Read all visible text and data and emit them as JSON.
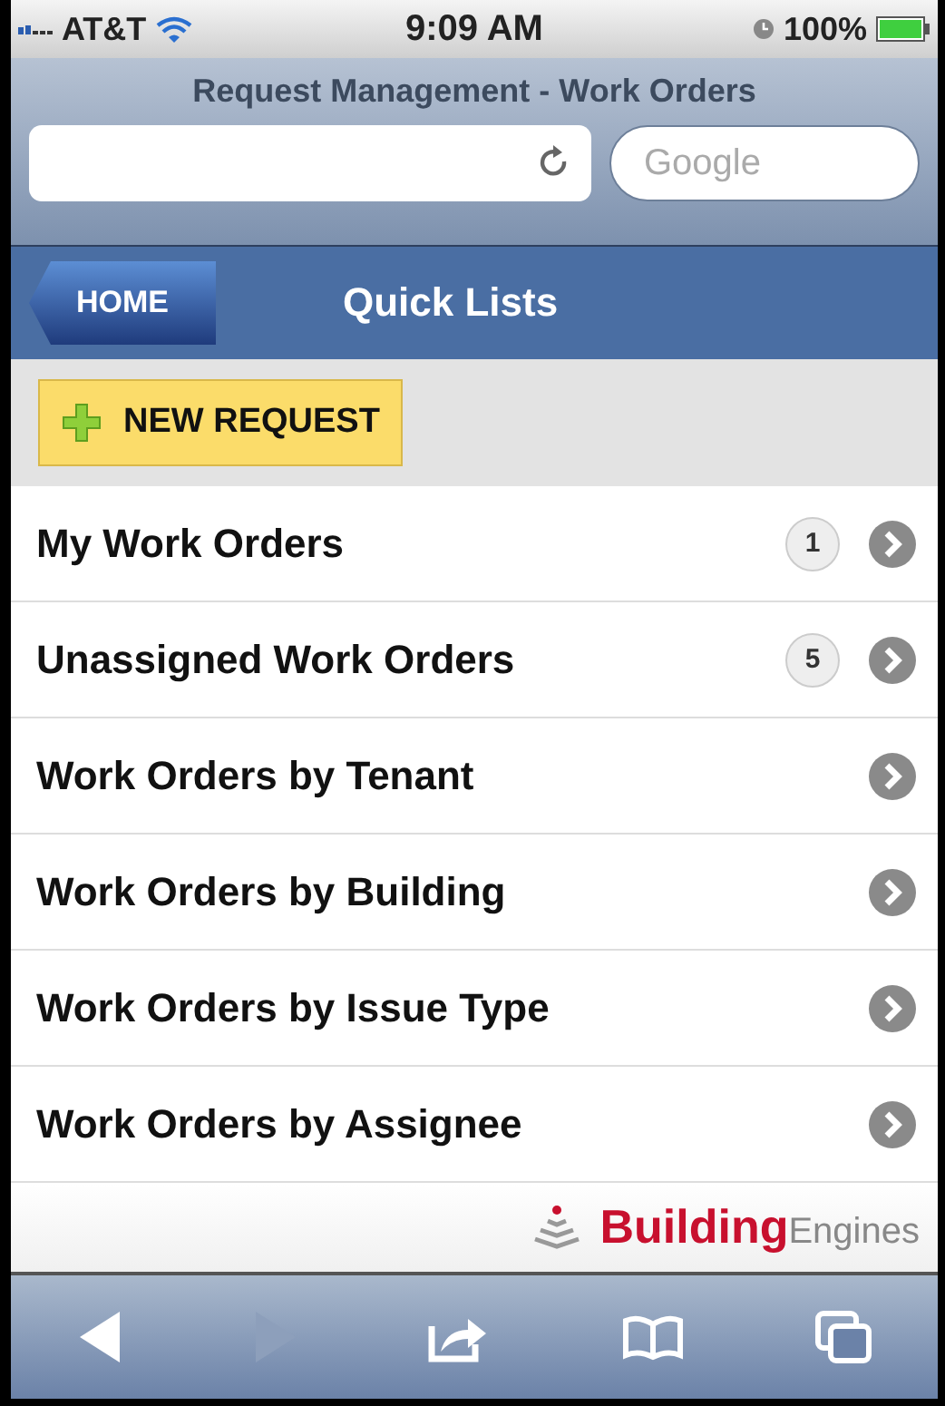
{
  "status_bar": {
    "carrier": "AT&T",
    "time": "9:09 AM",
    "battery": "100%"
  },
  "browser": {
    "page_title": "Request Management - Work Orders",
    "search": {
      "placeholder": "Google"
    }
  },
  "nav_bar": {
    "back_button": "HOME",
    "title": "Quick Lists"
  },
  "new_request_button": "NEW REQUEST",
  "quick_lists": [
    {
      "label": "My Work Orders",
      "count": "1"
    },
    {
      "label": "Unassigned Work Orders",
      "count": "5"
    },
    {
      "label": "Work Orders by Tenant"
    },
    {
      "label": "Work Orders by Building"
    },
    {
      "label": "Work Orders by Issue Type"
    },
    {
      "label": "Work Orders by Assignee"
    }
  ],
  "footer": {
    "logo": "**Building**Engines"
  },
  "toolbar": [
    {
      "kind": "back",
      "disabled": false
    },
    {
      "kind": "forward",
      "disabled": true
    },
    {
      "kind": "share",
      "disabled": false
    },
    {
      "kind": "bookmarks",
      "disabled": false
    },
    {
      "kind": "pages",
      "disabled": false
    }
  ]
}
